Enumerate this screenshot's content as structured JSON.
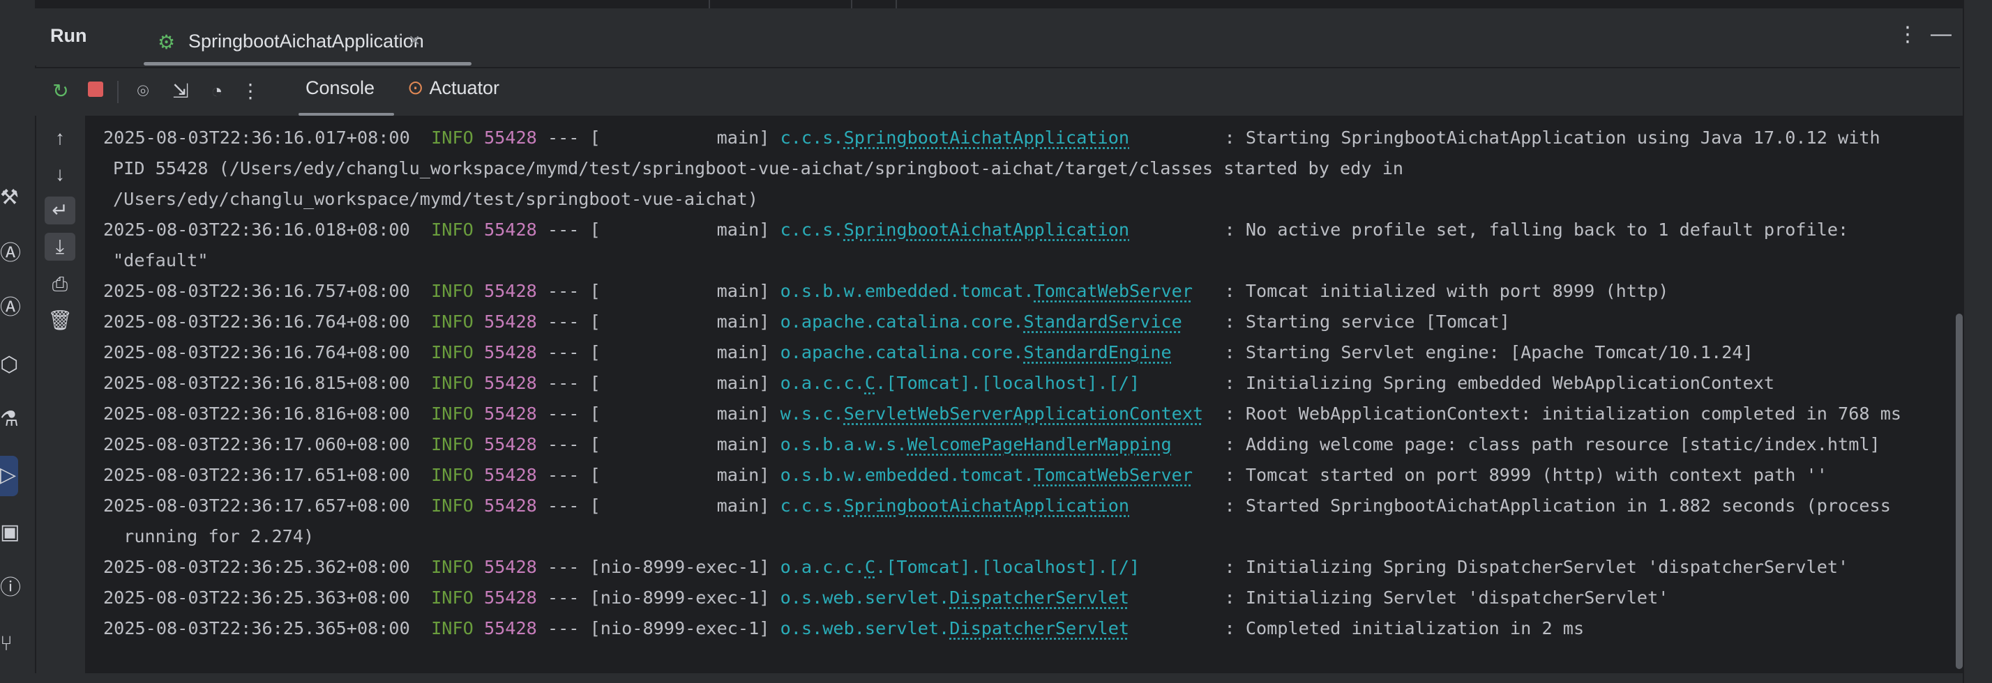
{
  "run_panel": {
    "title": "Run",
    "tab_label": "SpringbootAichatApplication",
    "tab_icon": "spring-run-icon",
    "close_glyph": "×"
  },
  "toolbar": {
    "tabs": [
      {
        "label": "Console",
        "active": true
      },
      {
        "label": "Actuator",
        "active": false
      }
    ]
  },
  "colors": {
    "info_level": "#6a9d3d",
    "pid": "#c77dbb",
    "logger": "#2aacb8",
    "stop_button": "#db5c5c"
  },
  "console": {
    "lines": [
      {
        "type": "log",
        "ts": "2025-08-03T22:36:16.017+08:00",
        "level": "INFO",
        "pid": "55428",
        "sep": "---",
        "thread": "[           main]",
        "logger_pkg": "c.c.s.",
        "logger_cls": "SpringbootAichatApplication",
        "logger_pad": "        ",
        "msg": ": Starting SpringbootAichatApplication using Java 17.0.12 with"
      },
      {
        "type": "cont",
        "text": "PID 55428 (/Users/edy/changlu_workspace/mymd/test/springboot-vue-aichat/springboot-aichat/target/classes started by edy in"
      },
      {
        "type": "cont",
        "text": "/Users/edy/changlu_workspace/mymd/test/springboot-vue-aichat)"
      },
      {
        "type": "log",
        "ts": "2025-08-03T22:36:16.018+08:00",
        "level": "INFO",
        "pid": "55428",
        "sep": "---",
        "thread": "[           main]",
        "logger_pkg": "c.c.s.",
        "logger_cls": "SpringbootAichatApplication",
        "logger_pad": "        ",
        "msg": ": No active profile set, falling back to 1 default profile:"
      },
      {
        "type": "cont",
        "text": "\"default\""
      },
      {
        "type": "log",
        "ts": "2025-08-03T22:36:16.757+08:00",
        "level": "INFO",
        "pid": "55428",
        "sep": "---",
        "thread": "[           main]",
        "logger_pkg": "o.s.b.w.embedded.tomcat.",
        "logger_cls": "TomcatWebServer",
        "logger_pad": "  ",
        "msg": ": Tomcat initialized with port 8999 (http)"
      },
      {
        "type": "log",
        "ts": "2025-08-03T22:36:16.764+08:00",
        "level": "INFO",
        "pid": "55428",
        "sep": "---",
        "thread": "[           main]",
        "logger_pkg": "o.apache.catalina.core.",
        "logger_cls": "StandardService",
        "logger_pad": "   ",
        "msg": ": Starting service [Tomcat]"
      },
      {
        "type": "log",
        "ts": "2025-08-03T22:36:16.764+08:00",
        "level": "INFO",
        "pid": "55428",
        "sep": "---",
        "thread": "[           main]",
        "logger_pkg": "o.apache.catalina.core.",
        "logger_cls": "StandardEngine",
        "logger_pad": "    ",
        "msg": ": Starting Servlet engine: [Apache Tomcat/10.1.24]"
      },
      {
        "type": "log",
        "ts": "2025-08-03T22:36:16.815+08:00",
        "level": "INFO",
        "pid": "55428",
        "sep": "---",
        "thread": "[           main]",
        "logger_pkg": "o.a.c.c.",
        "logger_cls": "C",
        "logger_tail": ".[Tomcat].[localhost].[/]",
        "logger_pad": "       ",
        "msg": ": Initializing Spring embedded WebApplicationContext"
      },
      {
        "type": "log",
        "ts": "2025-08-03T22:36:16.816+08:00",
        "level": "INFO",
        "pid": "55428",
        "sep": "---",
        "thread": "[           main]",
        "logger_pkg": "w.s.c.",
        "logger_cls": "ServletWebServerApplicationContext",
        "logger_pad": " ",
        "msg": ": Root WebApplicationContext: initialization completed in 768 ms"
      },
      {
        "type": "log",
        "ts": "2025-08-03T22:36:17.060+08:00",
        "level": "INFO",
        "pid": "55428",
        "sep": "---",
        "thread": "[           main]",
        "logger_pkg": "o.s.b.a.w.s.",
        "logger_cls": "WelcomePageHandlerMapping",
        "logger_pad": "    ",
        "msg": ": Adding welcome page: class path resource [static/index.html]"
      },
      {
        "type": "log",
        "ts": "2025-08-03T22:36:17.651+08:00",
        "level": "INFO",
        "pid": "55428",
        "sep": "---",
        "thread": "[           main]",
        "logger_pkg": "o.s.b.w.embedded.tomcat.",
        "logger_cls": "TomcatWebServer",
        "logger_pad": "  ",
        "msg": ": Tomcat started on port 8999 (http) with context path ''"
      },
      {
        "type": "log",
        "ts": "2025-08-03T22:36:17.657+08:00",
        "level": "INFO",
        "pid": "55428",
        "sep": "---",
        "thread": "[           main]",
        "logger_pkg": "c.c.s.",
        "logger_cls": "SpringbootAichatApplication",
        "logger_pad": "        ",
        "msg": ": Started SpringbootAichatApplication in 1.882 seconds (process"
      },
      {
        "type": "cont",
        "text": " running for 2.274)"
      },
      {
        "type": "log",
        "ts": "2025-08-03T22:36:25.362+08:00",
        "level": "INFO",
        "pid": "55428",
        "sep": "---",
        "thread": "[nio-8999-exec-1]",
        "logger_pkg": "o.a.c.c.",
        "logger_cls": "C",
        "logger_tail": ".[Tomcat].[localhost].[/]",
        "logger_pad": "       ",
        "msg": ": Initializing Spring DispatcherServlet 'dispatcherServlet'"
      },
      {
        "type": "log",
        "ts": "2025-08-03T22:36:25.363+08:00",
        "level": "INFO",
        "pid": "55428",
        "sep": "---",
        "thread": "[nio-8999-exec-1]",
        "logger_pkg": "o.s.web.servlet.",
        "logger_cls": "DispatcherServlet",
        "logger_pad": "        ",
        "msg": ": Initializing Servlet 'dispatcherServlet'"
      },
      {
        "type": "log",
        "ts": "2025-08-03T22:36:25.365+08:00",
        "level": "INFO",
        "pid": "55428",
        "sep": "---",
        "thread": "[nio-8999-exec-1]",
        "logger_pkg": "o.s.web.servlet.",
        "logger_cls": "DispatcherServlet",
        "logger_pad": "        ",
        "msg": ": Completed initialization in 2 ms"
      }
    ]
  }
}
